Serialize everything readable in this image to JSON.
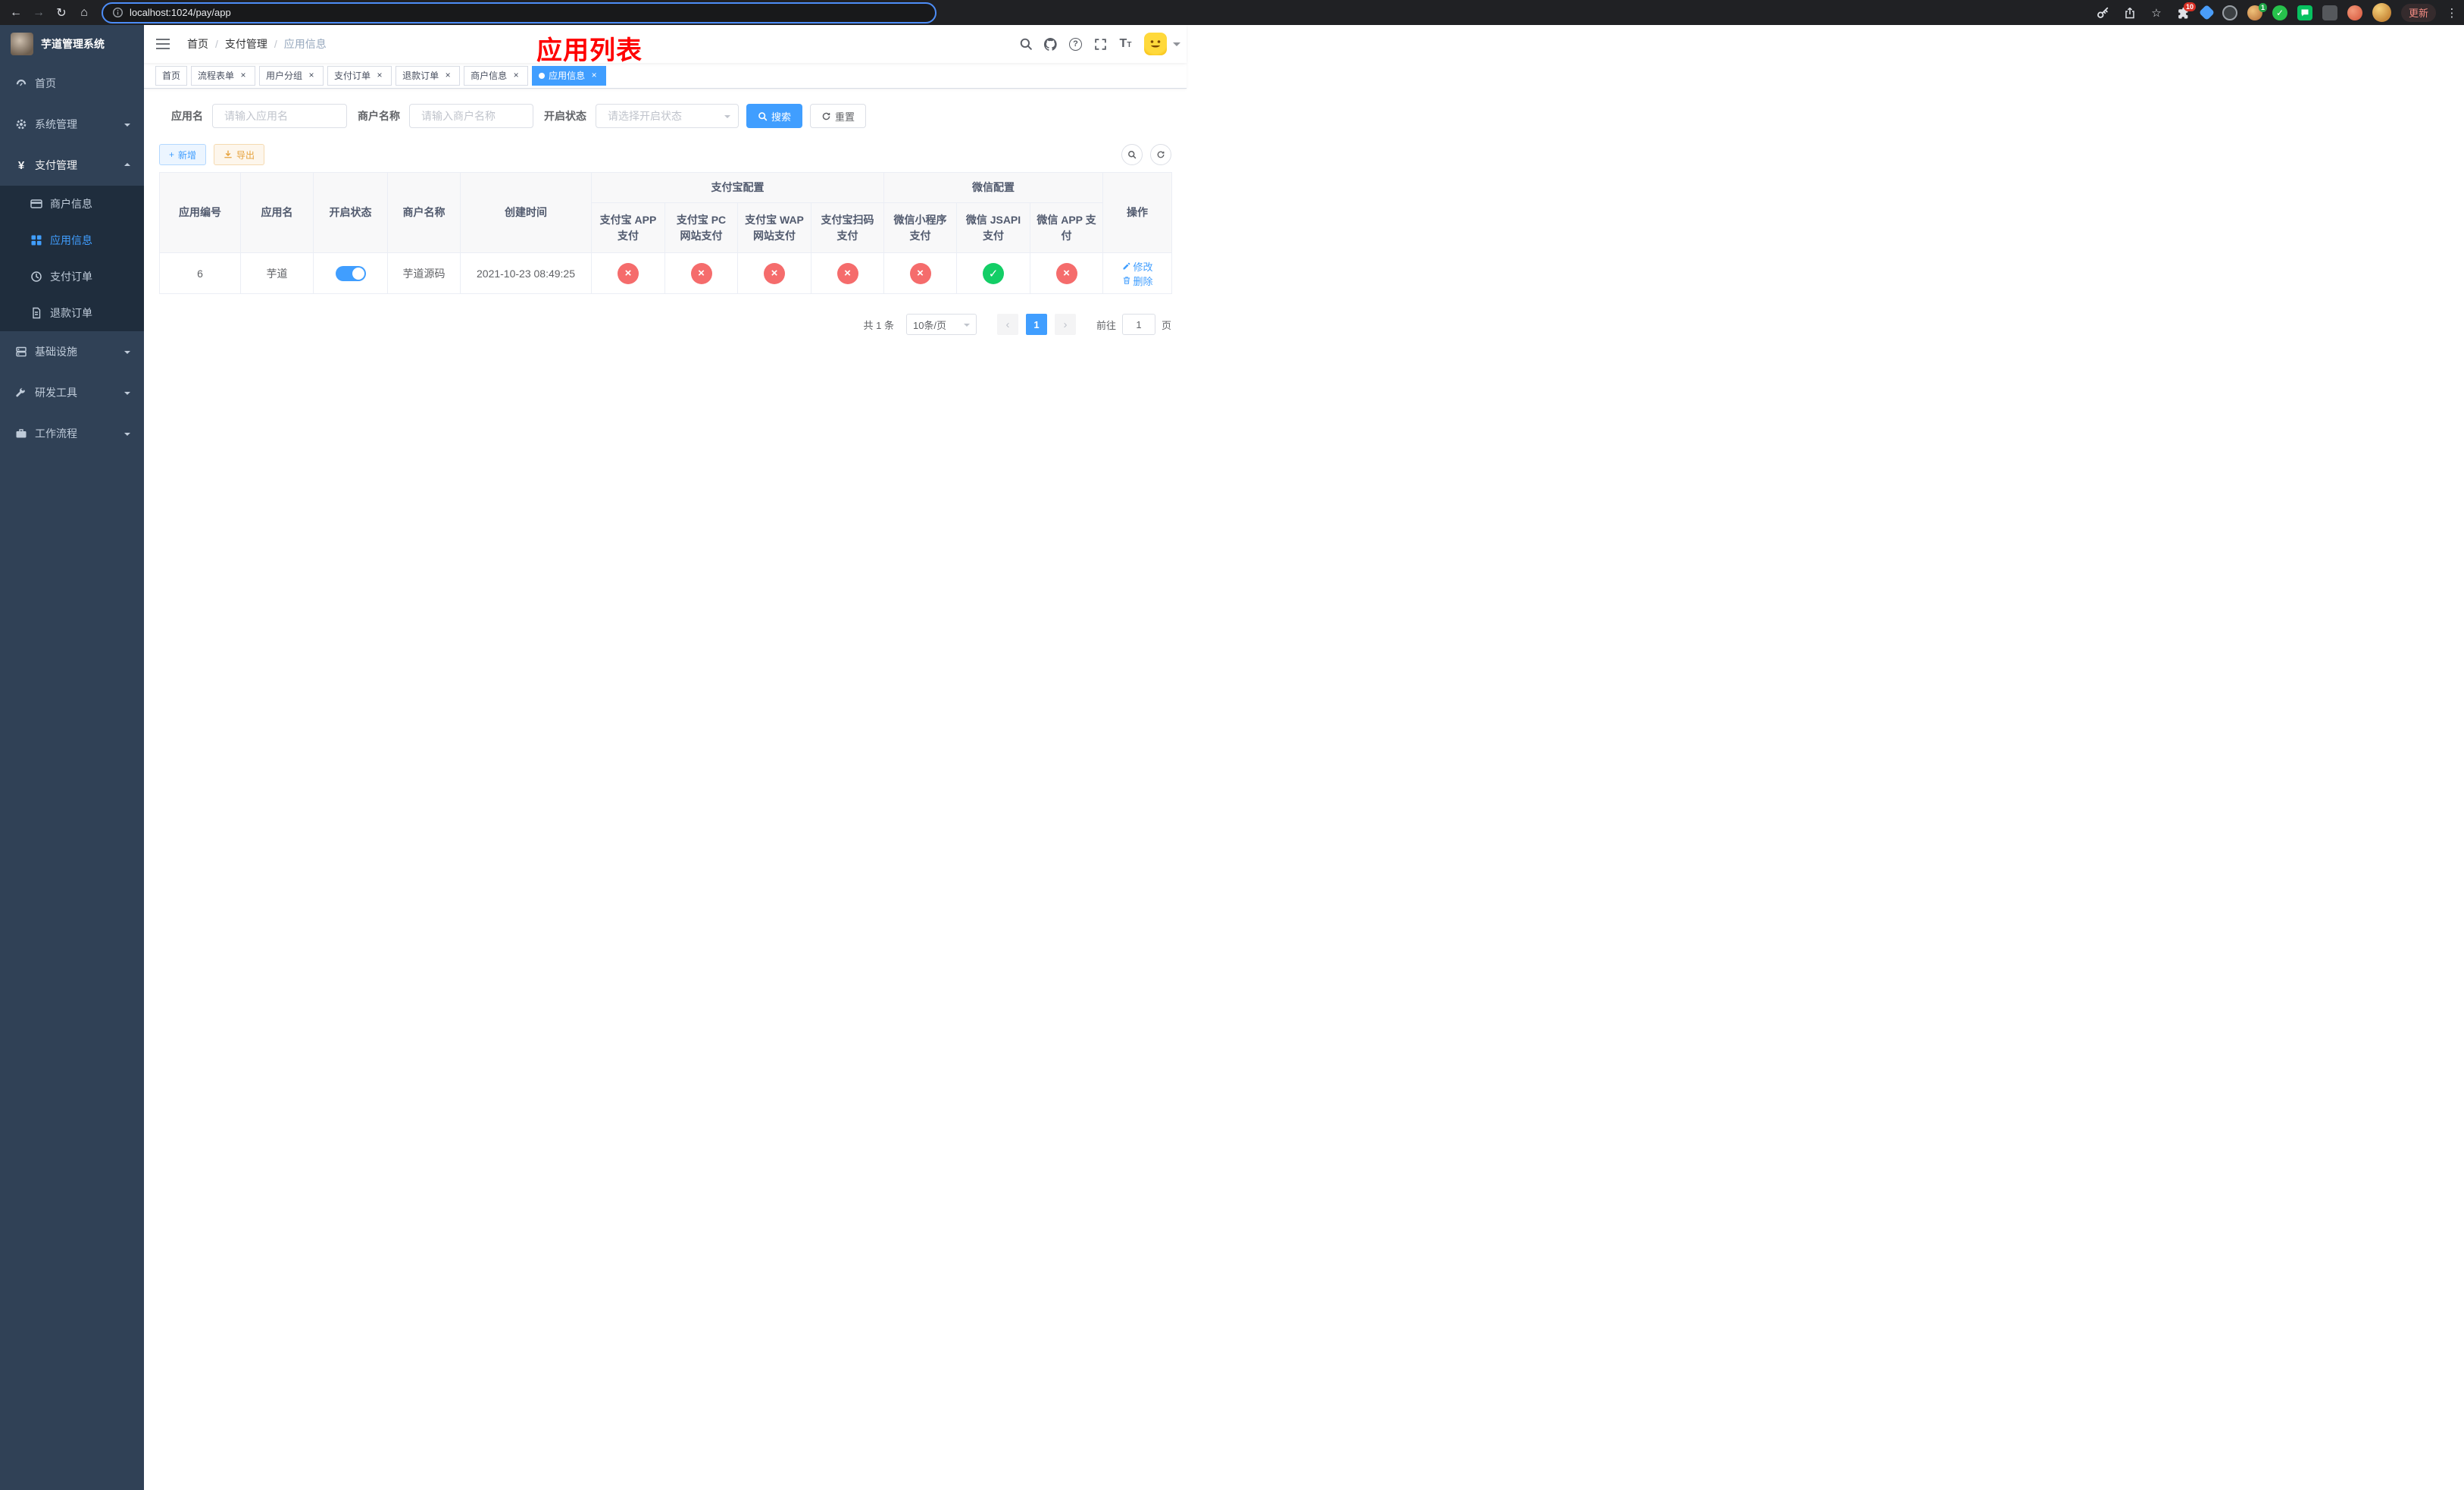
{
  "browser": {
    "url": "localhost:1024/pay/app",
    "update_label": "更新",
    "extensions_badge": "10",
    "profile_badge": "1"
  },
  "icons": {
    "back": "←",
    "forward": "→",
    "reload": "↻",
    "home": "⌂",
    "star": "☆",
    "menu_dots": "⋮",
    "question": "?",
    "font_big": "T",
    "font_small": "T",
    "plus": "+",
    "check": "✓",
    "cross": "×",
    "prev": "‹",
    "next": "›",
    "yen": "¥"
  },
  "sidebar": {
    "title": "芋道管理系统",
    "items": [
      {
        "label": "首页"
      },
      {
        "label": "系统管理"
      },
      {
        "label": "支付管理"
      },
      {
        "label": "商户信息"
      },
      {
        "label": "应用信息"
      },
      {
        "label": "支付订单"
      },
      {
        "label": "退款订单"
      },
      {
        "label": "基础设施"
      },
      {
        "label": "研发工具"
      },
      {
        "label": "工作流程"
      }
    ]
  },
  "navbar": {
    "breadcrumb": [
      "首页",
      "支付管理",
      "应用信息"
    ],
    "separator": "/",
    "annotation": "应用列表"
  },
  "tabs": [
    {
      "label": "首页"
    },
    {
      "label": "流程表单"
    },
    {
      "label": "用户分组"
    },
    {
      "label": "支付订单"
    },
    {
      "label": "退款订单"
    },
    {
      "label": "商户信息"
    },
    {
      "label": "应用信息"
    }
  ],
  "filters": {
    "app_name_label": "应用名",
    "app_name_placeholder": "请输入应用名",
    "merchant_label": "商户名称",
    "merchant_placeholder": "请输入商户名称",
    "status_label": "开启状态",
    "status_placeholder": "请选择开启状态",
    "search_label": "搜索",
    "reset_label": "重置"
  },
  "toolbar": {
    "add_label": "新增",
    "export_label": "导出"
  },
  "table": {
    "col_id": "应用编号",
    "col_name": "应用名",
    "col_status": "开启状态",
    "col_merchant": "商户名称",
    "col_created": "创建时间",
    "group_alipay": "支付宝配置",
    "group_wechat": "微信配置",
    "col_action": "操作",
    "sub": [
      "支付宝 APP 支付",
      "支付宝 PC 网站支付",
      "支付宝 WAP 网站支付",
      "支付宝扫码支付",
      "微信小程序支付",
      "微信 JSAPI 支付",
      "微信 APP 支付"
    ],
    "row": {
      "id": "6",
      "name": "芋道",
      "merchant": "芋道源码",
      "created": "2021-10-23 08:49:25",
      "marks": [
        false,
        false,
        false,
        false,
        false,
        true,
        false
      ],
      "edit_label": "修改",
      "delete_label": "删除"
    }
  },
  "pagination": {
    "total": "共 1 条",
    "page_size": "10条/页",
    "page": "1",
    "goto_prefix": "前往",
    "goto_value": "1",
    "goto_suffix": "页"
  },
  "colors": {
    "accent": "#409eff",
    "danger": "#f56c6c",
    "success": "#13ce66",
    "warning": "#e6a23c",
    "annotation_red": "#ff0000"
  }
}
